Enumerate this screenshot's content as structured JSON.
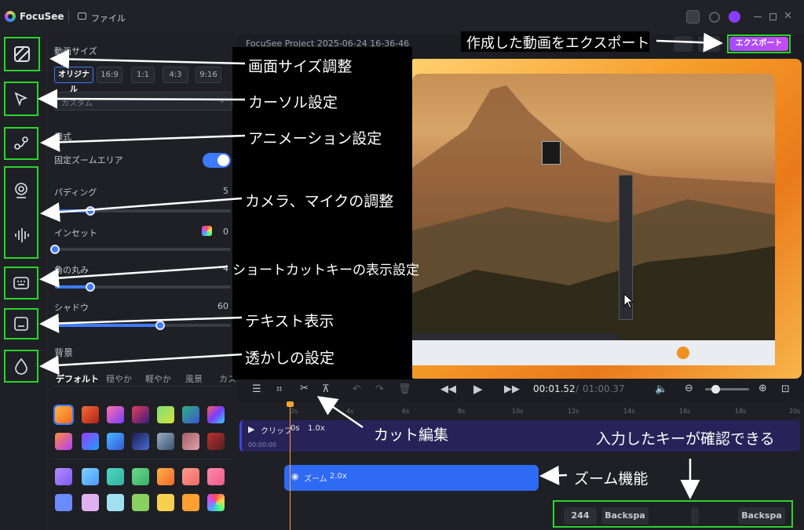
{
  "app": {
    "name": "FocuSee",
    "file_menu": "ファイル"
  },
  "project_title": "FocuSee Project 2025-06-24 16-36-46",
  "export_label": "エクスポート",
  "panel": {
    "video_size_label": "動画サイズ",
    "ratios": [
      "オリジナル",
      "16:9",
      "1:1",
      "4:3",
      "9:16"
    ],
    "custom_placeholder": "カスタム",
    "mode_label": "様式",
    "fixed_zoom_label": "固定ズームエリア",
    "padding_label": "パディング",
    "padding_value": "5",
    "padding_level": 0.2,
    "inset_label": "インセット",
    "inset_value": "0",
    "inset_level": 0.0,
    "radius_label": "角の丸み",
    "radius_value": "4",
    "radius_level": 0.2,
    "shadow_label": "シャドウ",
    "shadow_value": "60",
    "shadow_level": 0.6,
    "background_label": "背景",
    "bg_tabs": [
      "デフォルト",
      "穏やか",
      "軽やか",
      "風景",
      "カス"
    ]
  },
  "annotations": {
    "screen_size": "画面サイズ調整",
    "cursor": "カーソル設定",
    "animation": "アニメーション設定",
    "camera_mic": "カメラ、マイクの調整",
    "shortcut": "ショートカットキーの表示設定",
    "text": "テキスト表示",
    "watermark": "透かしの設定",
    "export_note": "作成した動画をエクスポート",
    "cut_note": "カット編集",
    "keys_note": "入力したキーが確認できる",
    "zoom_note": "ズーム機能"
  },
  "playback": {
    "current": "00:01.52",
    "separator": "/",
    "total": "01:00.37"
  },
  "ruler_ticks": [
    "2s",
    "4s",
    "6s",
    "8s",
    "10s",
    "12s",
    "14s",
    "16s",
    "18s",
    "20s"
  ],
  "clip": {
    "label": "クリップ",
    "duration": "0s",
    "speed": "1.0x",
    "timecode": "00:00:00"
  },
  "zoom": {
    "label": "ズーム",
    "value": "2.0x"
  },
  "keys": [
    "244",
    "Backspa",
    "Backspa"
  ],
  "colors": {
    "accent": "#3d7bff",
    "highlight": "#2ad52a",
    "export": "#a44cff",
    "zoom_track": "#2f6af5"
  }
}
